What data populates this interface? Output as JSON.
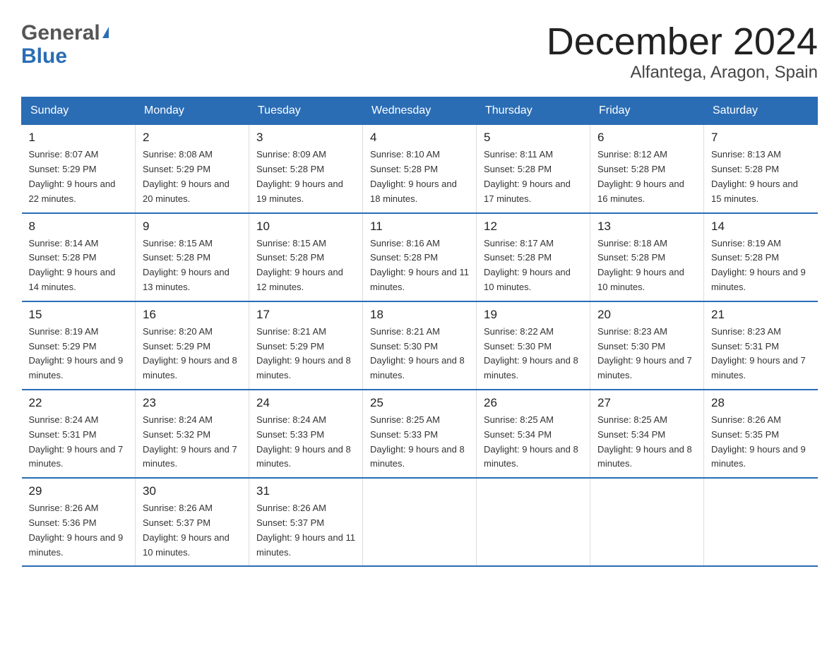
{
  "header": {
    "logo_general": "General",
    "logo_blue": "Blue",
    "month_title": "December 2024",
    "location": "Alfantega, Aragon, Spain"
  },
  "calendar": {
    "days_of_week": [
      "Sunday",
      "Monday",
      "Tuesday",
      "Wednesday",
      "Thursday",
      "Friday",
      "Saturday"
    ],
    "weeks": [
      [
        {
          "day": "1",
          "sunrise": "Sunrise: 8:07 AM",
          "sunset": "Sunset: 5:29 PM",
          "daylight": "Daylight: 9 hours and 22 minutes."
        },
        {
          "day": "2",
          "sunrise": "Sunrise: 8:08 AM",
          "sunset": "Sunset: 5:29 PM",
          "daylight": "Daylight: 9 hours and 20 minutes."
        },
        {
          "day": "3",
          "sunrise": "Sunrise: 8:09 AM",
          "sunset": "Sunset: 5:28 PM",
          "daylight": "Daylight: 9 hours and 19 minutes."
        },
        {
          "day": "4",
          "sunrise": "Sunrise: 8:10 AM",
          "sunset": "Sunset: 5:28 PM",
          "daylight": "Daylight: 9 hours and 18 minutes."
        },
        {
          "day": "5",
          "sunrise": "Sunrise: 8:11 AM",
          "sunset": "Sunset: 5:28 PM",
          "daylight": "Daylight: 9 hours and 17 minutes."
        },
        {
          "day": "6",
          "sunrise": "Sunrise: 8:12 AM",
          "sunset": "Sunset: 5:28 PM",
          "daylight": "Daylight: 9 hours and 16 minutes."
        },
        {
          "day": "7",
          "sunrise": "Sunrise: 8:13 AM",
          "sunset": "Sunset: 5:28 PM",
          "daylight": "Daylight: 9 hours and 15 minutes."
        }
      ],
      [
        {
          "day": "8",
          "sunrise": "Sunrise: 8:14 AM",
          "sunset": "Sunset: 5:28 PM",
          "daylight": "Daylight: 9 hours and 14 minutes."
        },
        {
          "day": "9",
          "sunrise": "Sunrise: 8:15 AM",
          "sunset": "Sunset: 5:28 PM",
          "daylight": "Daylight: 9 hours and 13 minutes."
        },
        {
          "day": "10",
          "sunrise": "Sunrise: 8:15 AM",
          "sunset": "Sunset: 5:28 PM",
          "daylight": "Daylight: 9 hours and 12 minutes."
        },
        {
          "day": "11",
          "sunrise": "Sunrise: 8:16 AM",
          "sunset": "Sunset: 5:28 PM",
          "daylight": "Daylight: 9 hours and 11 minutes."
        },
        {
          "day": "12",
          "sunrise": "Sunrise: 8:17 AM",
          "sunset": "Sunset: 5:28 PM",
          "daylight": "Daylight: 9 hours and 10 minutes."
        },
        {
          "day": "13",
          "sunrise": "Sunrise: 8:18 AM",
          "sunset": "Sunset: 5:28 PM",
          "daylight": "Daylight: 9 hours and 10 minutes."
        },
        {
          "day": "14",
          "sunrise": "Sunrise: 8:19 AM",
          "sunset": "Sunset: 5:28 PM",
          "daylight": "Daylight: 9 hours and 9 minutes."
        }
      ],
      [
        {
          "day": "15",
          "sunrise": "Sunrise: 8:19 AM",
          "sunset": "Sunset: 5:29 PM",
          "daylight": "Daylight: 9 hours and 9 minutes."
        },
        {
          "day": "16",
          "sunrise": "Sunrise: 8:20 AM",
          "sunset": "Sunset: 5:29 PM",
          "daylight": "Daylight: 9 hours and 8 minutes."
        },
        {
          "day": "17",
          "sunrise": "Sunrise: 8:21 AM",
          "sunset": "Sunset: 5:29 PM",
          "daylight": "Daylight: 9 hours and 8 minutes."
        },
        {
          "day": "18",
          "sunrise": "Sunrise: 8:21 AM",
          "sunset": "Sunset: 5:30 PM",
          "daylight": "Daylight: 9 hours and 8 minutes."
        },
        {
          "day": "19",
          "sunrise": "Sunrise: 8:22 AM",
          "sunset": "Sunset: 5:30 PM",
          "daylight": "Daylight: 9 hours and 8 minutes."
        },
        {
          "day": "20",
          "sunrise": "Sunrise: 8:23 AM",
          "sunset": "Sunset: 5:30 PM",
          "daylight": "Daylight: 9 hours and 7 minutes."
        },
        {
          "day": "21",
          "sunrise": "Sunrise: 8:23 AM",
          "sunset": "Sunset: 5:31 PM",
          "daylight": "Daylight: 9 hours and 7 minutes."
        }
      ],
      [
        {
          "day": "22",
          "sunrise": "Sunrise: 8:24 AM",
          "sunset": "Sunset: 5:31 PM",
          "daylight": "Daylight: 9 hours and 7 minutes."
        },
        {
          "day": "23",
          "sunrise": "Sunrise: 8:24 AM",
          "sunset": "Sunset: 5:32 PM",
          "daylight": "Daylight: 9 hours and 7 minutes."
        },
        {
          "day": "24",
          "sunrise": "Sunrise: 8:24 AM",
          "sunset": "Sunset: 5:33 PM",
          "daylight": "Daylight: 9 hours and 8 minutes."
        },
        {
          "day": "25",
          "sunrise": "Sunrise: 8:25 AM",
          "sunset": "Sunset: 5:33 PM",
          "daylight": "Daylight: 9 hours and 8 minutes."
        },
        {
          "day": "26",
          "sunrise": "Sunrise: 8:25 AM",
          "sunset": "Sunset: 5:34 PM",
          "daylight": "Daylight: 9 hours and 8 minutes."
        },
        {
          "day": "27",
          "sunrise": "Sunrise: 8:25 AM",
          "sunset": "Sunset: 5:34 PM",
          "daylight": "Daylight: 9 hours and 8 minutes."
        },
        {
          "day": "28",
          "sunrise": "Sunrise: 8:26 AM",
          "sunset": "Sunset: 5:35 PM",
          "daylight": "Daylight: 9 hours and 9 minutes."
        }
      ],
      [
        {
          "day": "29",
          "sunrise": "Sunrise: 8:26 AM",
          "sunset": "Sunset: 5:36 PM",
          "daylight": "Daylight: 9 hours and 9 minutes."
        },
        {
          "day": "30",
          "sunrise": "Sunrise: 8:26 AM",
          "sunset": "Sunset: 5:37 PM",
          "daylight": "Daylight: 9 hours and 10 minutes."
        },
        {
          "day": "31",
          "sunrise": "Sunrise: 8:26 AM",
          "sunset": "Sunset: 5:37 PM",
          "daylight": "Daylight: 9 hours and 11 minutes."
        },
        null,
        null,
        null,
        null
      ]
    ]
  }
}
